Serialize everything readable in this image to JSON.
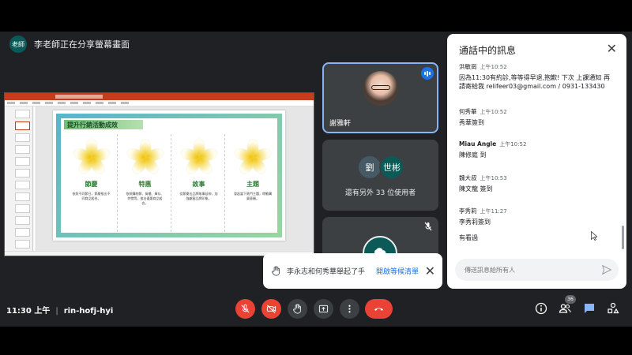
{
  "presenter_banner": {
    "avatar_label": "老師",
    "text": "李老師正在分享螢幕畫面"
  },
  "slide": {
    "title": "提升行銷活動成效",
    "columns": [
      {
        "name": "節慶",
        "desc": "依照不同節日，節慶推出不同商品組合。"
      },
      {
        "name": "特惠",
        "desc": "依照購物節、貨櫃、庫存、特價等，推出優惠商品組合。"
      },
      {
        "name": "故事",
        "desc": "從節慶出品牌故事延伸，加強顧客品牌印象。"
      },
      {
        "name": "主題",
        "desc": "發起當下熱門主題，帶動購買意願。"
      }
    ]
  },
  "tiles": {
    "active_name": "謝雅軒",
    "others_initials": [
      "劉",
      "世彬"
    ],
    "others_text": "還有另外 33 位使用者"
  },
  "toast": {
    "text": "李永志和何秀華舉起了手",
    "link": "開啟等候清單"
  },
  "chat": {
    "title": "通話中的訊息",
    "messages": [
      {
        "sender": "洪敏崗",
        "time": "上午10:52",
        "text": "因為11:30有約診,等等得早退,抱歉! 下次 上課通知 再請寄給我 relifeer03@gmail.com / 0931-133430"
      },
      {
        "sender": "何秀華",
        "time": "上午10:52",
        "text": "秀華簽到"
      },
      {
        "sender": "Miau Angle",
        "time": "上午10:52",
        "text": "陳修庭 到"
      },
      {
        "sender": "魏大叔",
        "time": "上午10:53",
        "text": "陳文龍 簽到"
      },
      {
        "sender": "李秀莉",
        "time": "上午11:27",
        "text": "李秀莉簽到"
      },
      {
        "sender": "",
        "time": "",
        "text": "有看過"
      }
    ],
    "input_placeholder": "傳送訊息給所有人"
  },
  "footer": {
    "time": "11:30 上午",
    "meeting_code": "rin-hofj-hyi",
    "participant_count": "36"
  },
  "colors": {
    "end_call": "#ea4335",
    "accent": "#1a73e8"
  }
}
